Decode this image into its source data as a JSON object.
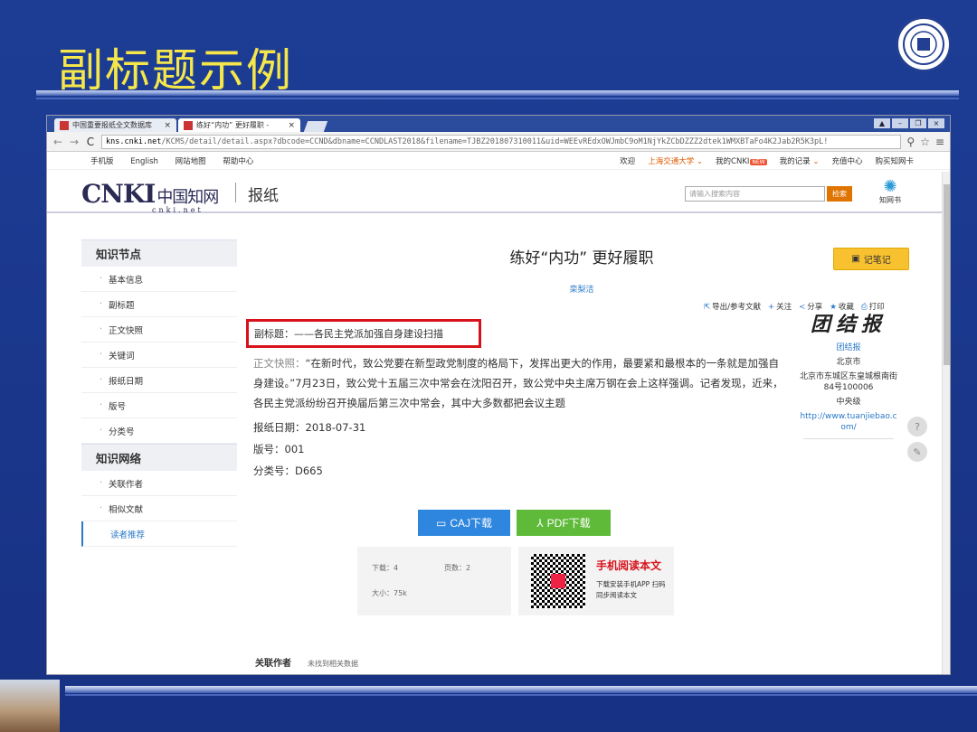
{
  "slide": {
    "title": "副标题示例"
  },
  "browser": {
    "tabs": [
      {
        "label": "中国重要报纸全文数据库"
      },
      {
        "label": "练好“内功” 更好履职 -"
      }
    ],
    "url_host": "kns.cnki.net",
    "url_path": "/KCMS/detail/detail.aspx?dbcode=CCND&dbname=CCNDLAST2018&filename=TJBZ201807310011&uid=WEEvREdxOWJmbC9oM1NjYkZCbDZZZ2dtek1WMXBTaFo4K2Jab2R5K3pL!"
  },
  "topnav": {
    "left": [
      "手机版",
      "English",
      "网站地图",
      "帮助中心"
    ],
    "welcome": "欢迎",
    "org": "上海交通大学",
    "mycnki": "我的CNKI",
    "new_badge": "NEW",
    "records": "我的记录",
    "recharge": "充值中心",
    "buy": "购买知网卡"
  },
  "brand": {
    "logo": "CNKI",
    "logo_cn": "中国知网",
    "logo_sub": "cnki.net",
    "section": "报纸",
    "search_placeholder": "请输入搜索内容",
    "search_button": "检索",
    "app_label": "知网书"
  },
  "sidebar": {
    "group1": "知识节点",
    "items1": [
      "基本信息",
      "副标题",
      "正文快照",
      "关键词",
      "报纸日期",
      "版号",
      "分类号"
    ],
    "group2": "知识网络",
    "items2": [
      "关联作者",
      "相似文献",
      "读者推荐"
    ]
  },
  "article": {
    "title": "练好“内功” 更好履职",
    "author": "栾梨洁",
    "note_button": "记笔记",
    "tools": [
      "导出/参考文献",
      "关注",
      "分享",
      "收藏",
      "打印"
    ],
    "subtitle": "副标题：——各民主党派加强自身建设扫描",
    "abstract_label": "正文快照：",
    "abstract": "“在新时代，致公党要在新型政党制度的格局下，发挥出更大的作用，最要紧和最根本的一条就是加强自身建设。”7月23日，致公党十五届三次中常会在沈阳召开，致公党中央主席万钢在会上这样强调。记者发现，近来，各民主党派纷纷召开换届后第三次中常会，其中大多数都把会议主题",
    "date": "报纸日期：2018-07-31",
    "edition": "版号：001",
    "classification": "分类号：D665"
  },
  "paper": {
    "logo": "团结报",
    "name": "团结报",
    "city": "北京市",
    "address": "北京市东城区东皇城根南街84号100006",
    "level": "中央级",
    "website": "http://www.tuanjiebao.com/"
  },
  "download": {
    "caj": "CAJ下载",
    "pdf": "PDF下载",
    "downloads": "下载：4",
    "pages": "页数：2",
    "size": "大小：75k",
    "mobile_title": "手机阅读本文",
    "mobile_desc": "下载安装手机APP 扫码同步阅读本文"
  },
  "footer_cut": {
    "label": "关联作者",
    "note": "未找到相关数据"
  }
}
